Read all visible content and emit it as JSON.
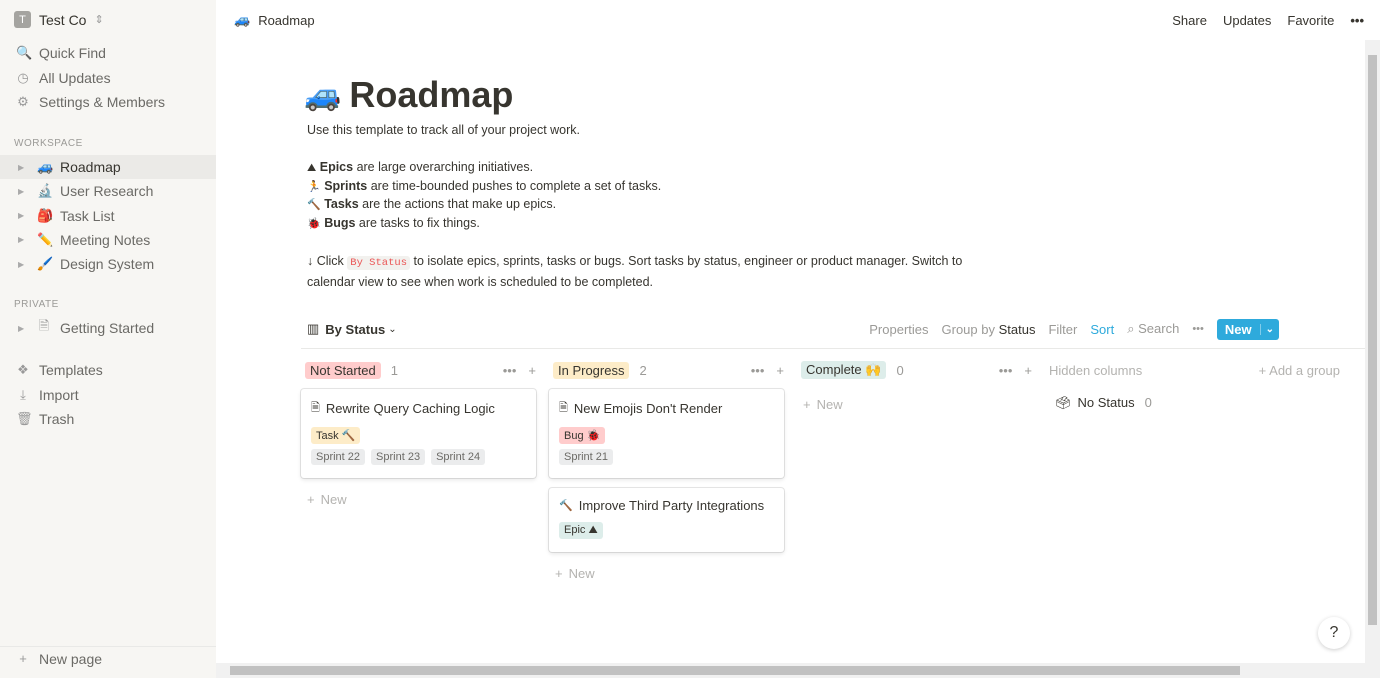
{
  "sidebar": {
    "workspace": "Test Co",
    "workspace_initial": "T",
    "top": [
      {
        "label": "Quick Find",
        "icon": "🔍"
      },
      {
        "label": "All Updates",
        "icon": "◷"
      },
      {
        "label": "Settings & Members",
        "icon": "⚙"
      }
    ],
    "workspace_label": "WORKSPACE",
    "pages": [
      {
        "label": "Roadmap",
        "icon": "🚙"
      },
      {
        "label": "User Research",
        "icon": "🔬"
      },
      {
        "label": "Task List",
        "icon": "🎒"
      },
      {
        "label": "Meeting Notes",
        "icon": "✏️"
      },
      {
        "label": "Design System",
        "icon": "🖌️"
      }
    ],
    "private_label": "PRIVATE",
    "private": [
      {
        "label": "Getting Started",
        "icon": "🗎"
      }
    ],
    "bottom": [
      {
        "label": "Templates",
        "icon": "❖"
      },
      {
        "label": "Import",
        "icon": "⤓"
      },
      {
        "label": "Trash",
        "icon": "🗑"
      }
    ],
    "new_page": "New page"
  },
  "topbar": {
    "crumb": "Roadmap",
    "crumb_icon": "🚙",
    "share": "Share",
    "updates": "Updates",
    "favorite": "Favorite",
    "more": "•••"
  },
  "page": {
    "icon": "🚙",
    "title": "Roadmap",
    "intro": "Use this template to track all of your project work.",
    "defs": [
      {
        "icon": "⛰",
        "bold": "Epics",
        "rest": " are large overarching initiatives."
      },
      {
        "icon": "🏃",
        "bold": "Sprints",
        "rest": " are time-bounded pushes to complete a set of tasks."
      },
      {
        "icon": "🔨",
        "bold": "Tasks",
        "rest": " are the actions that make up epics."
      },
      {
        "icon": "🐞",
        "bold": "Bugs",
        "rest": " are tasks to fix things."
      }
    ],
    "click_pre": "↓ Click ",
    "click_code": "By Status",
    "click_post": " to isolate epics, sprints, tasks or bugs. Sort tasks by status, engineer or product manager. Switch to",
    "click_line2": "calendar view to see when work is scheduled to be completed."
  },
  "view": {
    "name": "By Status",
    "properties": "Properties",
    "group_by": "Group by",
    "group_value": "Status",
    "filter": "Filter",
    "sort": "Sort",
    "search": "Search",
    "more": "•••",
    "new": "New"
  },
  "board": {
    "columns": [
      {
        "name": "Not Started",
        "count": "1",
        "color": "#ffcccc",
        "cards": [
          {
            "title": "Rewrite Query Caching Logic",
            "icon": "🗎",
            "type": "Task 🔨",
            "type_color": "#fdecc8",
            "sprints": [
              "Sprint 22",
              "Sprint 23",
              "Sprint 24"
            ]
          }
        ]
      },
      {
        "name": "In Progress",
        "count": "2",
        "color": "#fdecc8",
        "cards": [
          {
            "title": "New Emojis Don't Render",
            "icon": "🗎",
            "type": "Bug 🐞",
            "type_color": "#ffcccc",
            "sprints": [
              "Sprint 21"
            ]
          },
          {
            "title": "Improve Third Party Integrations",
            "icon": "🔨",
            "type": "Epic ⛰",
            "type_color": "#ddedea",
            "sprints": []
          }
        ]
      },
      {
        "name": "Complete 🙌",
        "count": "0",
        "color": "#ddedea",
        "cards": []
      }
    ],
    "new_label": "New",
    "hidden_columns": "Hidden columns",
    "add_group": "Add a group",
    "no_status": "No Status",
    "no_status_count": "0"
  },
  "help": "?"
}
